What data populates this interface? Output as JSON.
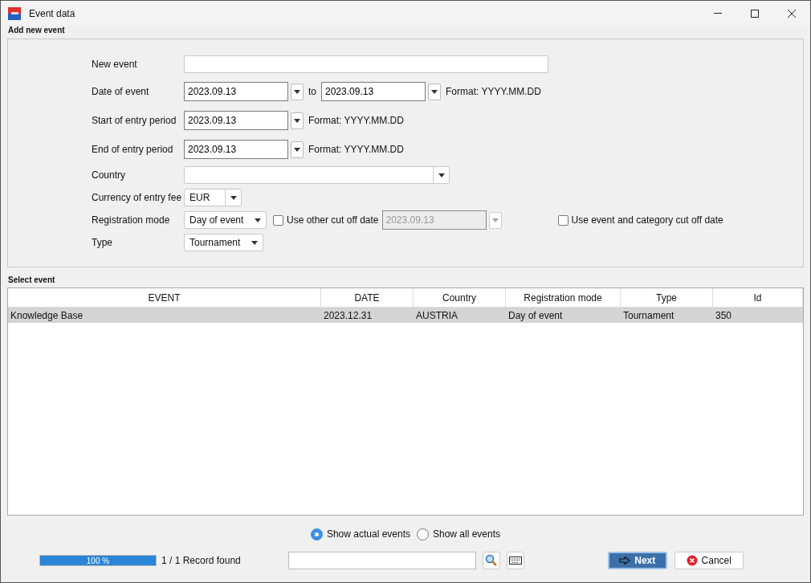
{
  "window": {
    "title": "Event data"
  },
  "add_event": {
    "legend": "Add new event",
    "new_event": {
      "label": "New event"
    },
    "date_of_event": {
      "label": "Date of event",
      "from": "2023.09.13",
      "to_label": "to",
      "to": "2023.09.13",
      "format": "Format: YYYY.MM.DD"
    },
    "start_entry": {
      "label": "Start of entry period",
      "value": "2023.09.13",
      "format": "Format: YYYY.MM.DD"
    },
    "end_entry": {
      "label": "End of entry period",
      "value": "2023.09.13",
      "format": "Format: YYYY.MM.DD"
    },
    "country": {
      "label": "Country"
    },
    "currency": {
      "label": "Currency of entry fee",
      "value": "EUR"
    },
    "registration": {
      "label": "Registration mode",
      "value": "Day of event",
      "other_cutoff": {
        "label": "Use other cut off date",
        "checked": false,
        "date": "2023.09.13",
        "disabled": true
      },
      "category_cutoff": {
        "label": "Use event and category cut off date",
        "checked": false
      }
    },
    "type": {
      "label": "Type",
      "value": "Tournament"
    }
  },
  "select_event": {
    "legend": "Select event",
    "columns": [
      "EVENT",
      "DATE",
      "Country",
      "Registration mode",
      "Type",
      "Id"
    ],
    "rows": [
      {
        "cells": [
          "Knowledge Base",
          "2023.12.31",
          "AUSTRIA",
          "Day of event",
          "Tournament",
          "350"
        ],
        "selected": true
      }
    ]
  },
  "filter": [
    {
      "label": "Show actual events",
      "selected": true
    },
    {
      "label": "Show all events",
      "selected": false
    }
  ],
  "footer": {
    "progress": {
      "level": 1,
      "text": "100 %"
    },
    "record_text": "1 / 1 Record found",
    "next": "Next",
    "cancel": "Cancel"
  }
}
